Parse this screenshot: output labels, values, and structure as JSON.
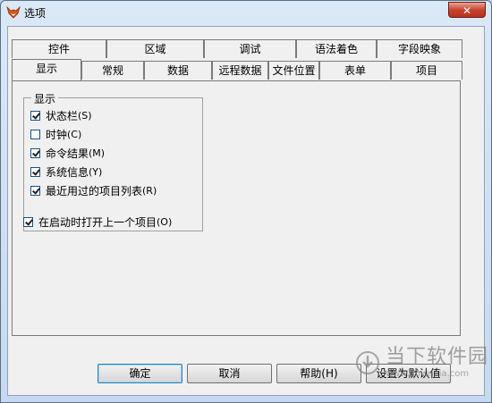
{
  "window": {
    "title": "选项",
    "close_label": "✕"
  },
  "tabs_back": [
    "控件",
    "区域",
    "调试",
    "语法着色",
    "字段映象"
  ],
  "tabs_front": [
    "显示",
    "常规",
    "数据",
    "远程数据",
    "文件位置",
    "表单",
    "项目"
  ],
  "active_tab": "显示",
  "display_group": {
    "label": "显示",
    "items": [
      {
        "label": "状态栏",
        "key": "(S)",
        "checked": true
      },
      {
        "label": "时钟",
        "key": "(C)",
        "checked": false
      },
      {
        "label": "命令结果",
        "key": "(M)",
        "checked": true
      },
      {
        "label": "系统信息",
        "key": "(Y)",
        "checked": true
      },
      {
        "label": "最近用过的项目列表",
        "key": "(R)",
        "checked": true
      }
    ]
  },
  "open_last_project": {
    "label": "在启动时打开上一个项目",
    "key": "(O)",
    "checked": true
  },
  "buttons": {
    "ok": "确定",
    "cancel": "取消",
    "help": "帮助(H)",
    "set_default": "设置为默认值"
  },
  "watermark": {
    "main": "当下软件园",
    "sub": "www.downxia.com"
  }
}
